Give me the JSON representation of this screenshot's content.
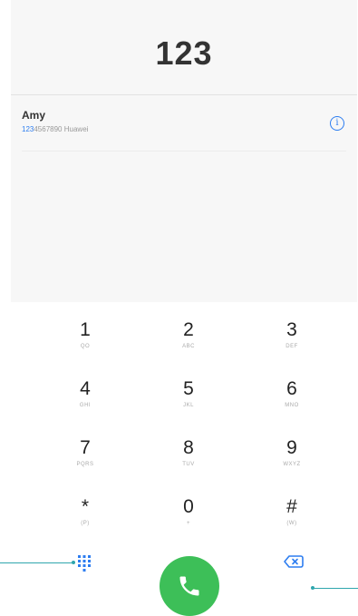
{
  "dialer": {
    "dialed_number": "123"
  },
  "search_result": {
    "name": "Amy",
    "number_highlight": "123",
    "number_rest": "4567890",
    "label": "Huawei",
    "info_icon": "info-icon"
  },
  "keypad": {
    "keys": [
      {
        "digit": "1",
        "letters": "QO"
      },
      {
        "digit": "2",
        "letters": "ABC"
      },
      {
        "digit": "3",
        "letters": "DEF"
      },
      {
        "digit": "4",
        "letters": "GHI"
      },
      {
        "digit": "5",
        "letters": "JKL"
      },
      {
        "digit": "6",
        "letters": "MNO"
      },
      {
        "digit": "7",
        "letters": "PQRS"
      },
      {
        "digit": "8",
        "letters": "TUV"
      },
      {
        "digit": "9",
        "letters": "WXYZ"
      },
      {
        "digit": "*",
        "letters": "(P)"
      },
      {
        "digit": "0",
        "letters": "+"
      },
      {
        "digit": "#",
        "letters": "(W)"
      }
    ]
  },
  "bottom_bar": {
    "keypad_toggle_icon": "dialpad-icon",
    "call_icon": "phone-icon",
    "backspace_icon": "backspace-icon",
    "call_color": "#3dbf58"
  },
  "colors": {
    "accent": "#2d7df0",
    "callout": "#2fa6ad"
  }
}
